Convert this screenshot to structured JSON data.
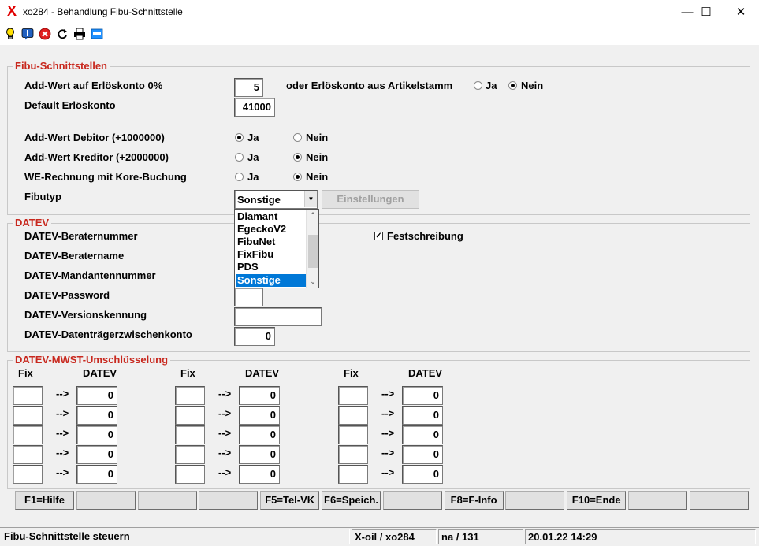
{
  "window": {
    "title": "xo284 - Behandlung Fibu-Schnittstelle",
    "logo": "X",
    "minimize": "—",
    "maximize": "☐",
    "close": "✕"
  },
  "toolbar": {
    "icons": [
      "lightbulb-icon",
      "info-icon",
      "cancel-icon",
      "refresh-icon",
      "print-icon",
      "screen-icon"
    ]
  },
  "fibu": {
    "legend": "Fibu-Schnittstellen",
    "add_wert_label": "Add-Wert auf Erlöskonto 0%",
    "add_wert_value": "5",
    "oder_label": "oder Erlöskonto aus Artikelstamm",
    "oder_ja": "Ja",
    "oder_nein": "Nein",
    "oder_selected": "Nein",
    "default_label": "Default Erlöskonto",
    "default_value": "41000",
    "debitor_label": "Add-Wert Debitor (+1000000)",
    "debitor_ja": "Ja",
    "debitor_nein": "Nein",
    "debitor_selected": "Ja",
    "kreditor_label": "Add-Wert Kreditor (+2000000)",
    "kreditor_ja": "Ja",
    "kreditor_nein": "Nein",
    "kreditor_selected": "Nein",
    "we_label": "WE-Rechnung mit Kore-Buchung",
    "we_ja": "Ja",
    "we_nein": "Nein",
    "we_selected": "Nein",
    "fibutyp_label": "Fibutyp",
    "fibutyp_value": "Sonstige",
    "fibutyp_options": [
      "Diamant",
      "EgeckoV2",
      "FibuNet",
      "FixFibu",
      "PDS",
      "Sonstige"
    ],
    "einstellungen_button": "Einstellungen"
  },
  "datev": {
    "legend": "DATEV",
    "beraternummer_label": "DATEV-Beraternummer",
    "beratername_label": "DATEV-Beratername",
    "mandantennummer_label": "DATEV-Mandantennummer",
    "password_label": "DATEV-Password",
    "versionskennung_label": "DATEV-Versionskennung",
    "zwischenkonto_label": "DATEV-Datenträgerzwischenkonto",
    "zwischenkonto_value": "0",
    "festschreibung_label": "Festschreibung",
    "festschreibung_checked": true,
    "check_mark": "✓"
  },
  "mwst": {
    "legend": "DATEV-MWST-Umschlüsselung",
    "fix_header": "Fix",
    "datev_header": "DATEV",
    "arrow": "-->",
    "columns": [
      {
        "values": [
          "0",
          "0",
          "0",
          "0",
          "0"
        ]
      },
      {
        "values": [
          "0",
          "0",
          "0",
          "0",
          "0"
        ]
      },
      {
        "values": [
          "0",
          "0",
          "0",
          "0",
          "0"
        ]
      }
    ]
  },
  "fkeys": [
    "F1=Hilfe",
    "",
    "",
    "",
    "F5=Tel-VK",
    "F6=Speich.",
    "",
    "F8=F-Info",
    "",
    "F10=Ende",
    "",
    ""
  ],
  "status": {
    "message": "Fibu-Schnittstelle steuern",
    "app": "X-oil / xo284",
    "user": "na / 131",
    "datetime": "20.01.22 14:29"
  }
}
